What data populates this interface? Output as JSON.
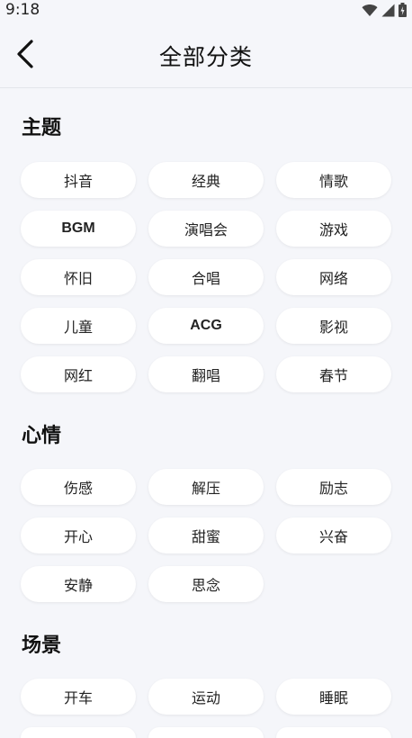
{
  "status_bar": {
    "time": "9:18"
  },
  "header": {
    "title": "全部分类"
  },
  "sections": {
    "theme": {
      "title": "主题",
      "chips": [
        "抖音",
        "经典",
        "情歌",
        "BGM",
        "演唱会",
        "游戏",
        "怀旧",
        "合唱",
        "网络",
        "儿童",
        "ACG",
        "影视",
        "网红",
        "翻唱",
        "春节"
      ]
    },
    "mood": {
      "title": "心情",
      "chips": [
        "伤感",
        "解压",
        "励志",
        "开心",
        "甜蜜",
        "兴奋",
        "安静",
        "思念"
      ]
    },
    "scene": {
      "title": "场景",
      "chips": [
        "开车",
        "运动",
        "睡眠"
      ]
    }
  },
  "colors": {
    "background": "#f5f6fa",
    "chip_background": "#ffffff",
    "text": "#111111"
  }
}
